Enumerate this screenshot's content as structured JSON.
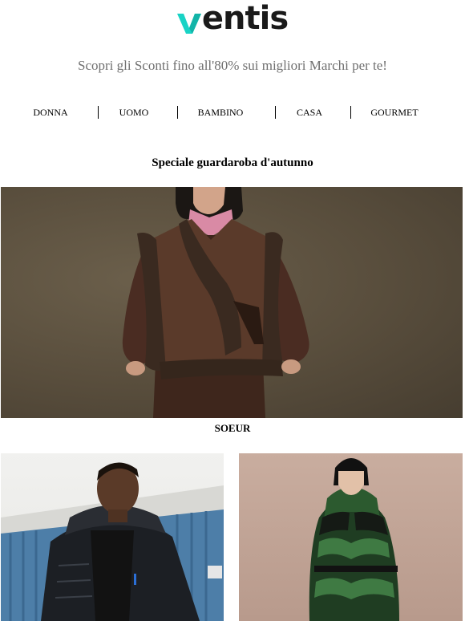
{
  "brand": {
    "name": "ventis",
    "accent_color": "#19d3c5"
  },
  "tagline": "Scopri gli Sconti fino all'80% sui migliori Marchi per te!",
  "nav": {
    "items": [
      "DONNA",
      "UOMO",
      "BAMBINO",
      "CASA",
      "GOURMET"
    ]
  },
  "section": {
    "title": "Speciale guardaroba d'autunno"
  },
  "hero": {
    "caption": "SOEUR"
  },
  "products": [
    {
      "image": "man-black-puffer-jacket-photo"
    },
    {
      "image": "woman-green-puffer-coat-photo"
    }
  ]
}
